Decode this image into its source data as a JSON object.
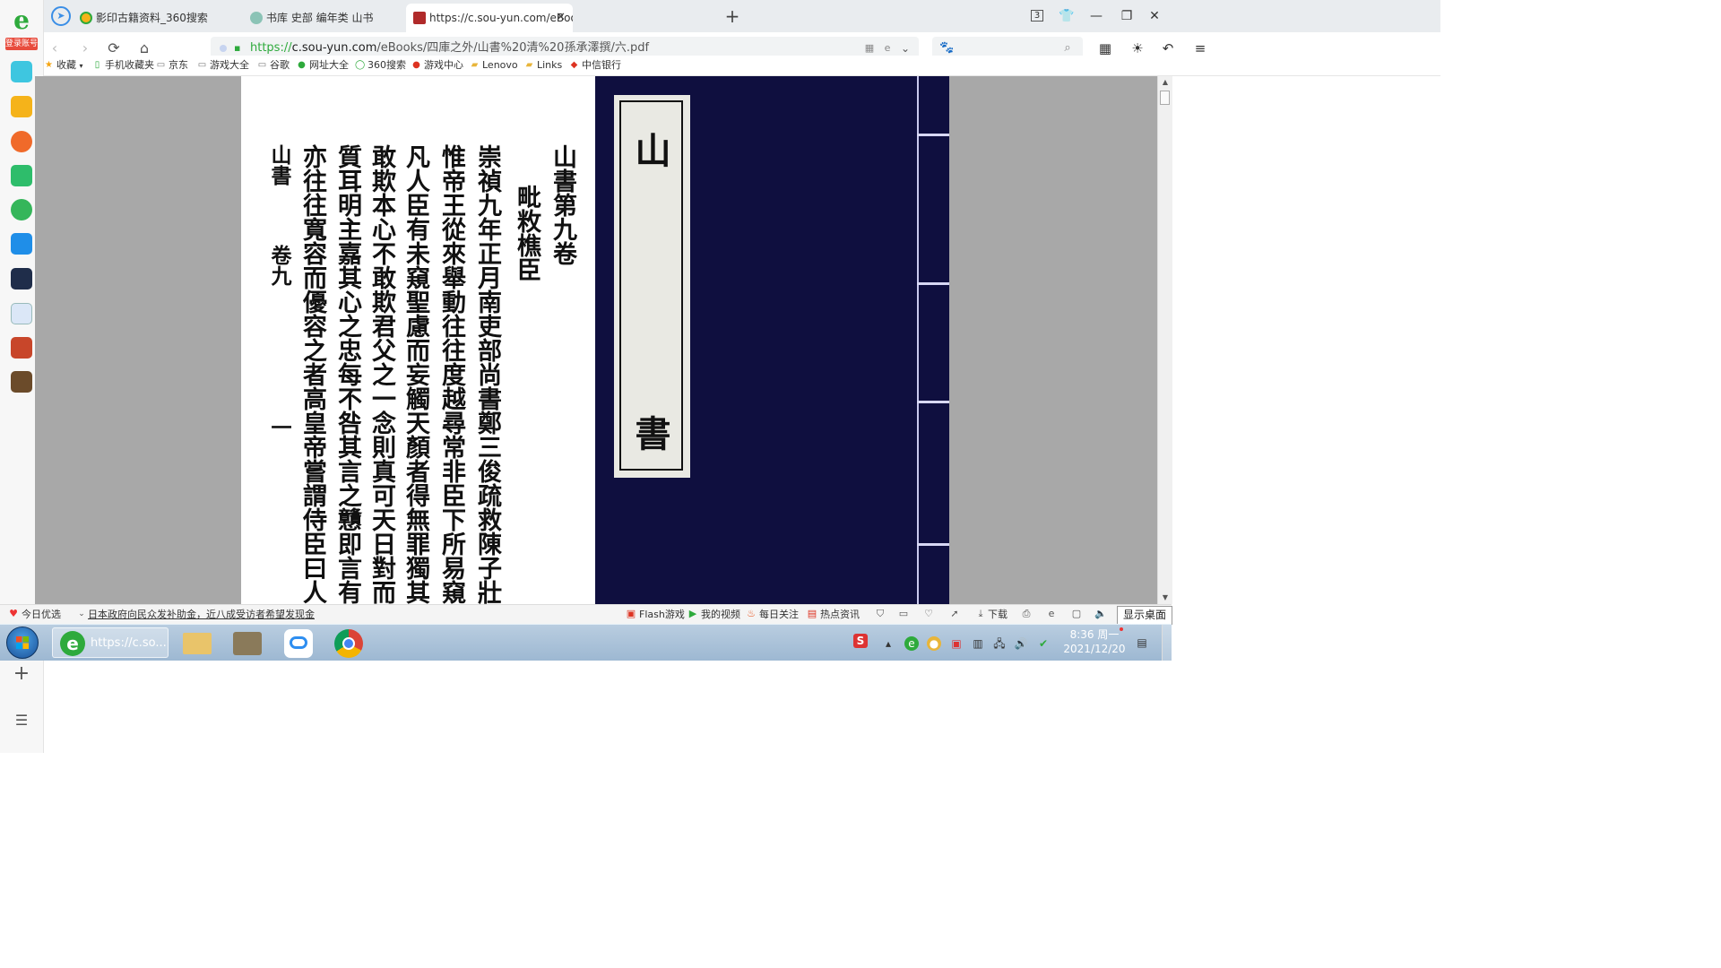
{
  "browser": {
    "sidebar_badge": "登录账号",
    "tabs": [
      {
        "title": "影印古籍资料_360搜索",
        "active": false
      },
      {
        "title": "书库 史部 编年类 山书",
        "active": false
      },
      {
        "title": "https://c.sou-yun.com/eBook",
        "active": true
      }
    ],
    "tab_count": "3",
    "url": {
      "scheme": "https://",
      "host": "c.sou-yun.com",
      "path": "/eBooks/四庫之外/山書%20清%20孫承澤撰/六.pdf"
    },
    "bookmarks": [
      {
        "label": "收藏",
        "icon": "star-icon"
      },
      {
        "label": "手机收藏夹",
        "icon": "phone-icon"
      },
      {
        "label": "京东",
        "icon": "page-icon"
      },
      {
        "label": "游戏大全",
        "icon": "page-icon"
      },
      {
        "label": "谷歌",
        "icon": "page-icon"
      },
      {
        "label": "网址大全",
        "icon": "globe-icon"
      },
      {
        "label": "360搜索",
        "icon": "search-360-icon"
      },
      {
        "label": "游戏中心",
        "icon": "game-icon"
      },
      {
        "label": "Lenovo",
        "icon": "folder-icon"
      },
      {
        "label": "Links",
        "icon": "folder-icon"
      },
      {
        "label": "中信银行",
        "icon": "bank-icon"
      }
    ]
  },
  "document": {
    "columns": [
      {
        "text": "山書第九卷",
        "size": "normal"
      },
      {
        "text": "毗敉樵臣",
        "size": "normal"
      },
      {
        "text": "崇禎九年正月南吏部尚書鄭三俊疏救陳子壯曰竊",
        "size": "normal"
      },
      {
        "text": "惟帝王從來舉動往往度越尋常非臣下所易窺測故",
        "size": "normal"
      },
      {
        "text": "凡人臣有未窺聖慮而妄觸天顏者得無罪獨其不",
        "size": "normal"
      },
      {
        "text": "敢欺本心不敢欺君父之一念則真可天日對而鬼神",
        "size": "normal"
      },
      {
        "text": "質耳明主嘉其心之忠每不咎其言之戇即言有不當",
        "size": "normal"
      },
      {
        "text": "亦往往寬容而優容之者高皇帝嘗謂侍臣曰人君深",
        "size": "normal"
      },
      {
        "text": "山書",
        "size": "small"
      },
      {
        "text": "卷九",
        "size": "small"
      },
      {
        "text": "一",
        "size": "small"
      }
    ],
    "cover_title": [
      "山",
      "書"
    ]
  },
  "statusbar": {
    "left": [
      {
        "label": "今日优选"
      },
      {
        "label": "日本政府向民众发补助金，近八成受访者希望发现金"
      }
    ],
    "right": [
      {
        "label": "Flash游戏"
      },
      {
        "label": "我的视频"
      },
      {
        "label": "每日关注"
      },
      {
        "label": "热点资讯"
      },
      {
        "label": "下载"
      }
    ],
    "show_desktop": "显示桌面"
  },
  "taskbar": {
    "active_app_label": "https://c.so...",
    "time": "8:36 周一",
    "date": "2021/12/20"
  },
  "colors": {
    "accent_green": "#2eaa3c",
    "cover_blue": "#0f0f3f",
    "viewer_gray": "#a8a8a8"
  }
}
